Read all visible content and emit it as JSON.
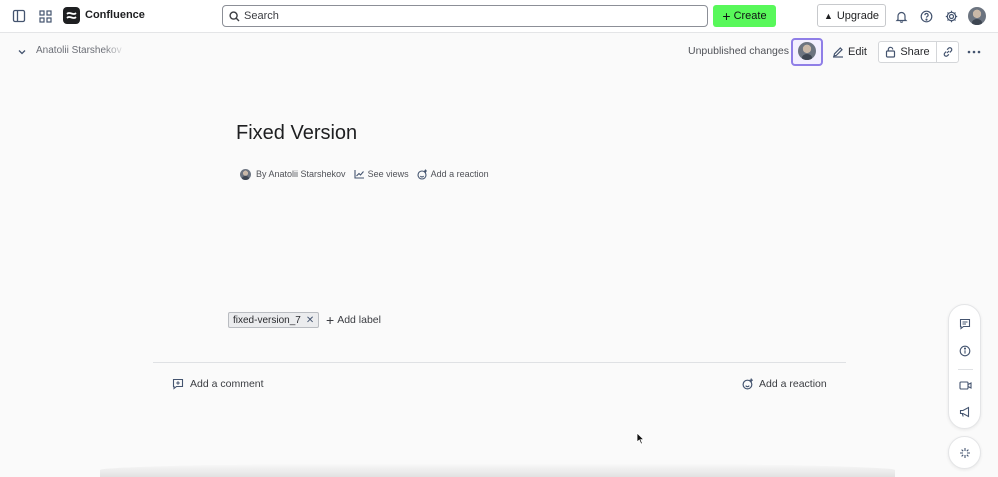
{
  "topbar": {
    "app_name": "Confluence",
    "search_placeholder": "Search",
    "create_label": "Create",
    "upgrade_label": "Upgrade",
    "icons": [
      "sidebar-toggle-icon",
      "app-switcher-icon",
      "confluence-logo-icon",
      "search-icon",
      "bell-icon",
      "help-icon",
      "settings-icon",
      "user-avatar"
    ]
  },
  "breadcrumb": {
    "space_name": "Anatolii Starshekov"
  },
  "page_actions": {
    "status": "Unpublished changes",
    "edit_label": "Edit",
    "share_label": "Share"
  },
  "page": {
    "title": "Fixed Version",
    "byline_author": "By Anatolii Starshekov",
    "see_views": "See views",
    "add_reaction": "Add a reaction"
  },
  "labels": {
    "items": [
      "fixed-version_7"
    ],
    "add_label": "Add label"
  },
  "footer": {
    "add_comment": "Add a comment",
    "add_reaction": "Add a reaction"
  },
  "colors": {
    "create_button": "#58f85a",
    "collaborator_ring": "#8f7ee7"
  }
}
